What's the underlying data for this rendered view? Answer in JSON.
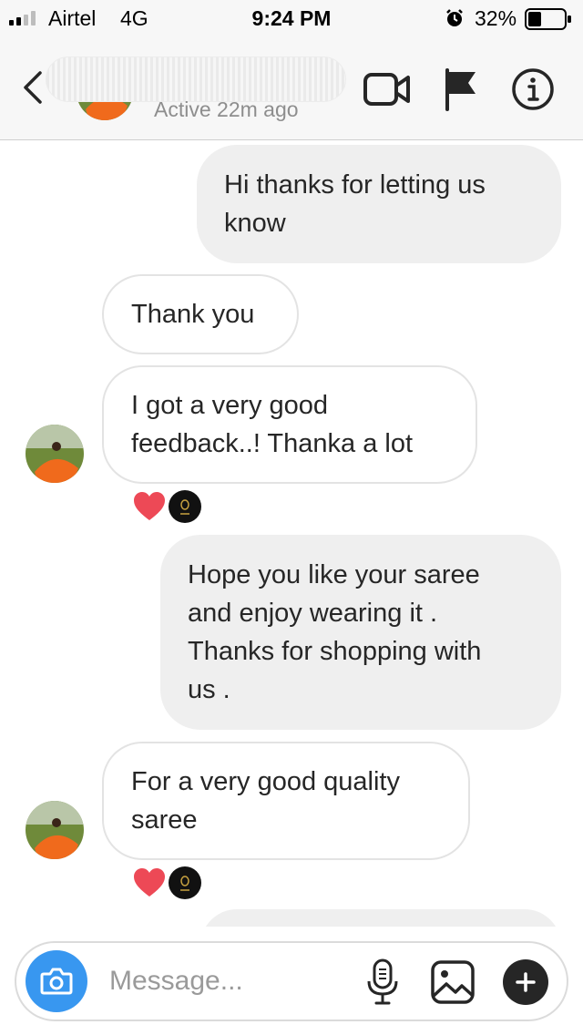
{
  "status_bar": {
    "carrier": "Airtel",
    "network": "4G",
    "time": "9:24 PM",
    "battery": "32%",
    "signal_bars": 2
  },
  "header": {
    "active_status": "Active 22m ago",
    "icons": [
      "back-icon",
      "video-call-icon",
      "flag-icon",
      "info-icon"
    ]
  },
  "messages": [
    {
      "direction": "sent",
      "lines": [
        "Hi thanks for letting us",
        "know"
      ]
    },
    {
      "direction": "received",
      "lines": [
        "Thank you"
      ]
    },
    {
      "direction": "received",
      "lines": [
        "I got a very good",
        "feedback..! Thanka a lot"
      ],
      "reactions": [
        "heart",
        "avatar"
      ]
    },
    {
      "direction": "sent",
      "lines": [
        "Hope you like your saree",
        "and enjoy wearing it .",
        "Thanks for shopping with",
        "us ."
      ]
    },
    {
      "direction": "received",
      "lines": [
        "For a very good quality",
        "saree"
      ],
      "reactions": [
        "heart",
        "avatar"
      ]
    }
  ],
  "composer": {
    "placeholder": "Message...",
    "icons": [
      "camera-icon",
      "microphone-icon",
      "gallery-icon",
      "add-icon"
    ]
  },
  "colors": {
    "accent": "#3897f0",
    "heart": "#ed4956",
    "sent_bubble": "#efefef",
    "text": "#262626",
    "secondary_text": "#8e8e8e"
  }
}
